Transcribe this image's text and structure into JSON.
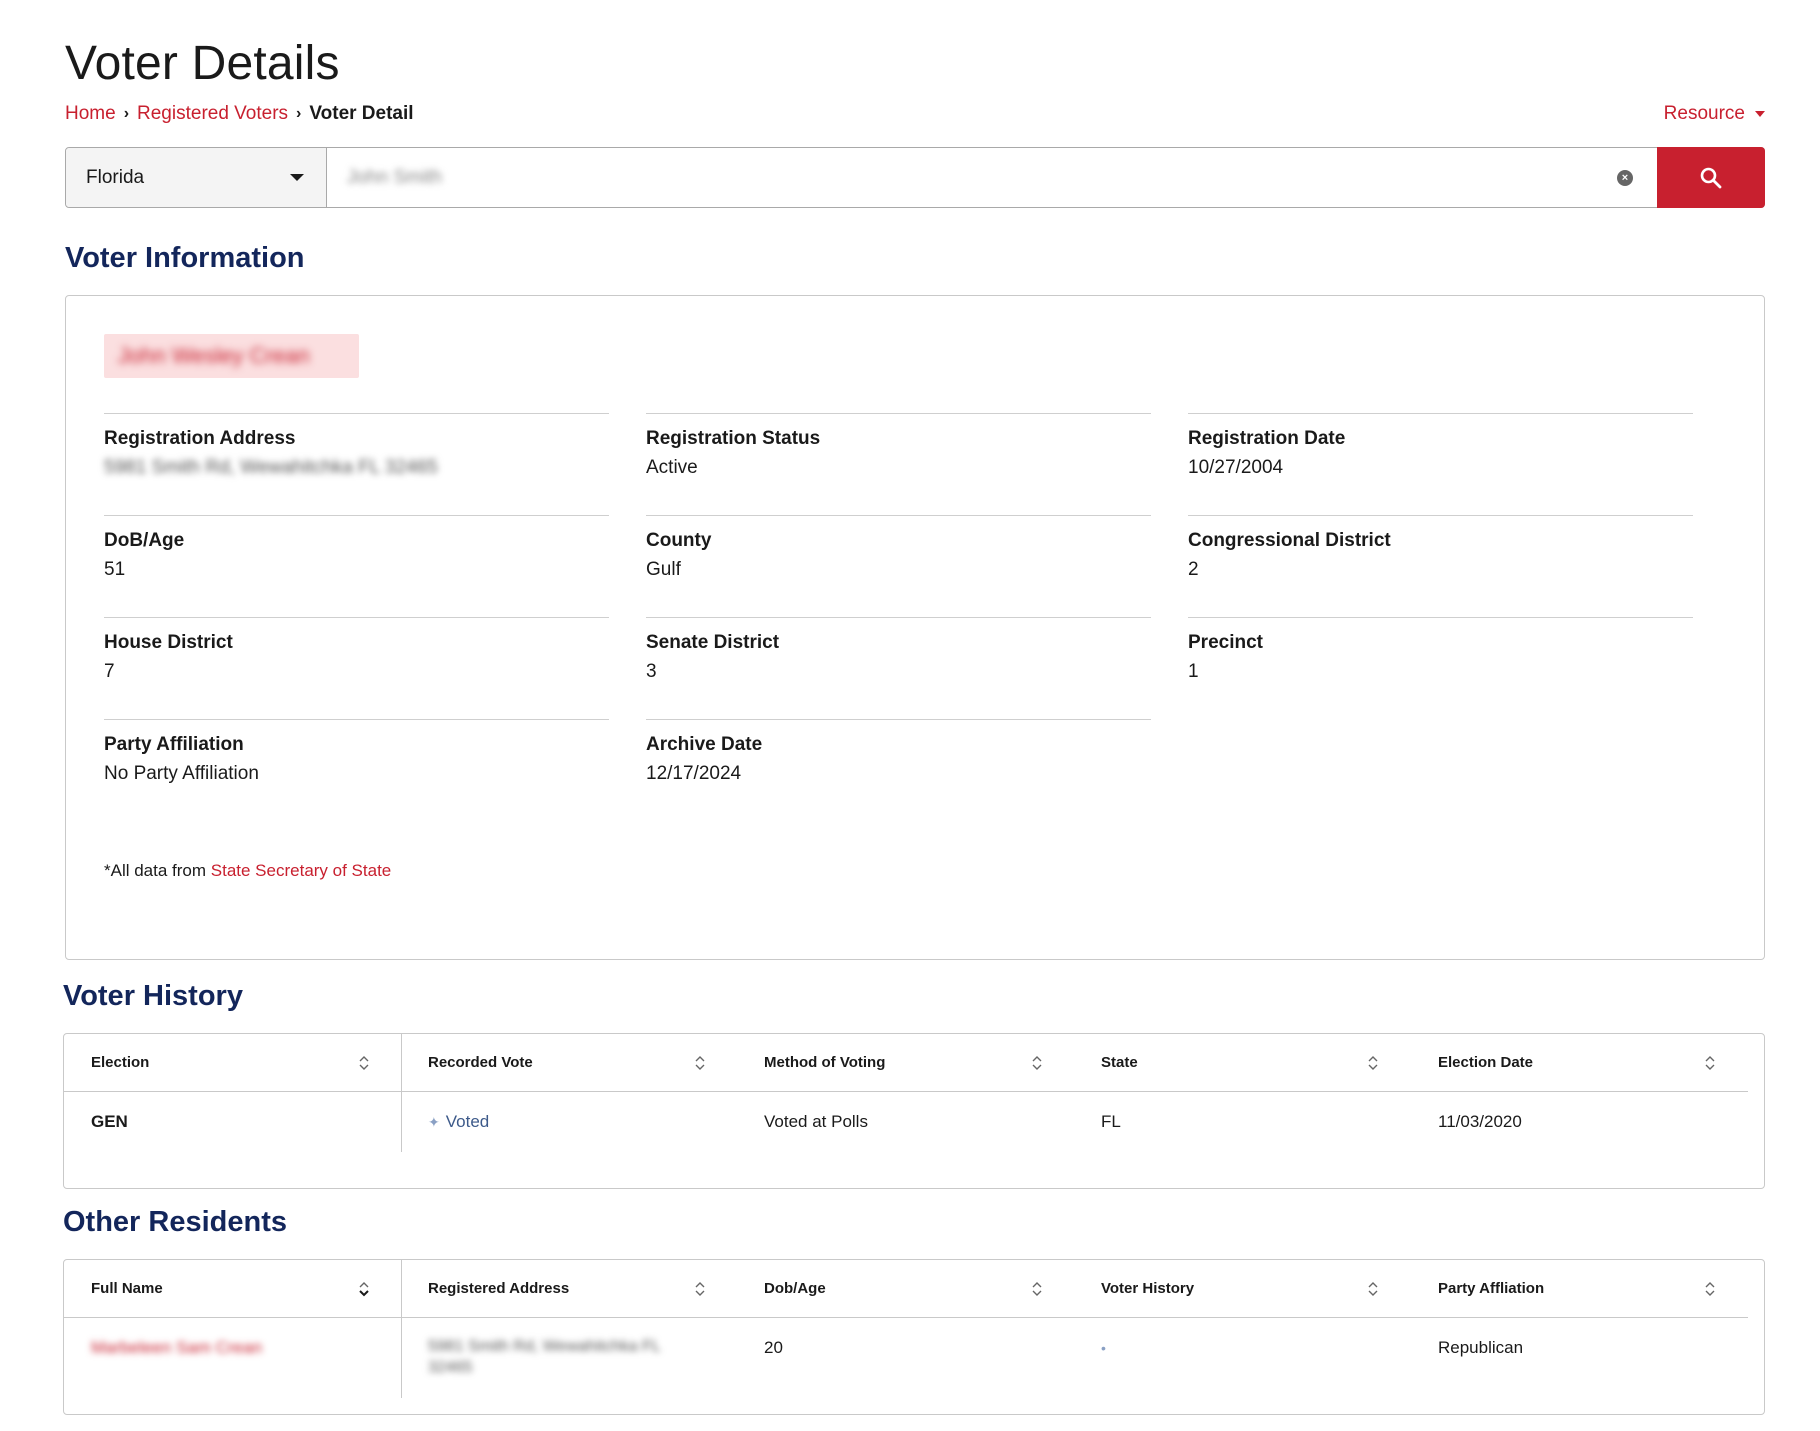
{
  "page_title": "Voter Details",
  "breadcrumb": {
    "items": [
      "Home",
      "Registered Voters"
    ],
    "current": "Voter Detail"
  },
  "resource_menu": {
    "label": "Resource"
  },
  "search": {
    "state": "Florida",
    "query": "John Smith"
  },
  "voter_information": {
    "title": "Voter Information",
    "name": "John Wesley Crean",
    "fields": [
      {
        "label": "Registration Address",
        "value": "5981 Smith Rd, Wewahitchka FL 32465"
      },
      {
        "label": "Registration Status",
        "value": "Active"
      },
      {
        "label": "Registration Date",
        "value": "10/27/2004"
      },
      {
        "label": "DoB/Age",
        "value": "51"
      },
      {
        "label": "County",
        "value": "Gulf"
      },
      {
        "label": "Congressional District",
        "value": "2"
      },
      {
        "label": "House District",
        "value": "7"
      },
      {
        "label": "Senate District",
        "value": "3"
      },
      {
        "label": "Precinct",
        "value": "1"
      },
      {
        "label": "Party Affiliation",
        "value": "No Party Affiliation"
      },
      {
        "label": "Archive Date",
        "value": "12/17/2024"
      }
    ],
    "source_prefix": "*All data from ",
    "source_link": "State Secretary of State"
  },
  "voter_history": {
    "title": "Voter History",
    "columns": [
      "Election",
      "Recorded Vote",
      "Method of Voting",
      "State",
      "Election Date"
    ],
    "rows": [
      {
        "election": "GEN",
        "recorded_vote": "Voted",
        "method": "Voted at Polls",
        "state": "FL",
        "date": "11/03/2020"
      }
    ]
  },
  "other_residents": {
    "title": "Other Residents",
    "columns": [
      "Full Name",
      "Registered Address",
      "Dob/Age",
      "Voter History",
      "Party Affliation"
    ],
    "rows": [
      {
        "name": "Marbeleen Sam Crean",
        "address_line1": "5981 Smith Rd, Wewahitchka FL",
        "address_line2": "32465",
        "age": "20",
        "history": "•",
        "party": "Republican"
      }
    ]
  },
  "colors": {
    "accent": "#c8202f",
    "heading": "#13265b"
  }
}
